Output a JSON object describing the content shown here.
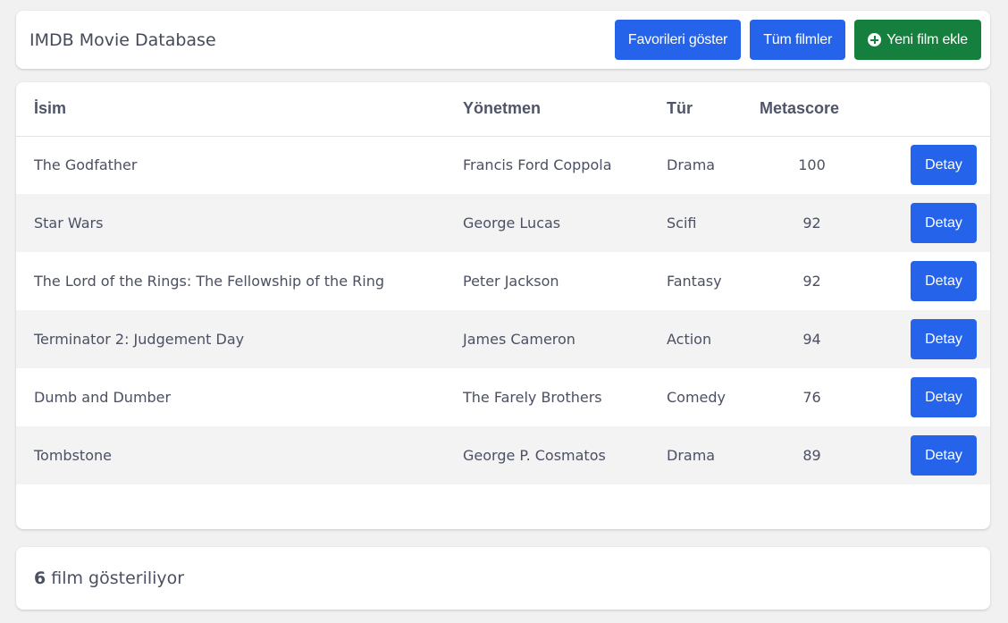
{
  "header": {
    "title": "IMDB Movie Database",
    "favorites_label": "Favorileri göster",
    "all_label": "Tüm filmler",
    "add_label": "Yeni film ekle",
    "add_icon": "plus-circle-icon"
  },
  "table": {
    "columns": [
      "İsim",
      "Yönetmen",
      "Tür",
      "Metascore"
    ],
    "detail_label": "Detay",
    "rows": [
      {
        "name": "The Godfather",
        "director": "Francis Ford Coppola",
        "genre": "Drama",
        "metascore": "100"
      },
      {
        "name": "Star Wars",
        "director": "George Lucas",
        "genre": "Scifi",
        "metascore": "92"
      },
      {
        "name": "The Lord of the Rings: The Fellowship of the Ring",
        "director": "Peter Jackson",
        "genre": "Fantasy",
        "metascore": "92"
      },
      {
        "name": "Terminator 2: Judgement Day",
        "director": "James Cameron",
        "genre": "Action",
        "metascore": "94"
      },
      {
        "name": "Dumb and Dumber",
        "director": "The Farely Brothers",
        "genre": "Comedy",
        "metascore": "76"
      },
      {
        "name": "Tombstone",
        "director": "George P. Cosmatos",
        "genre": "Drama",
        "metascore": "89"
      }
    ]
  },
  "footer": {
    "count": "6",
    "text": "film gösteriliyor"
  },
  "colors": {
    "primary": "#2563eb",
    "success": "#15803d",
    "background": "#f1f1f2"
  }
}
